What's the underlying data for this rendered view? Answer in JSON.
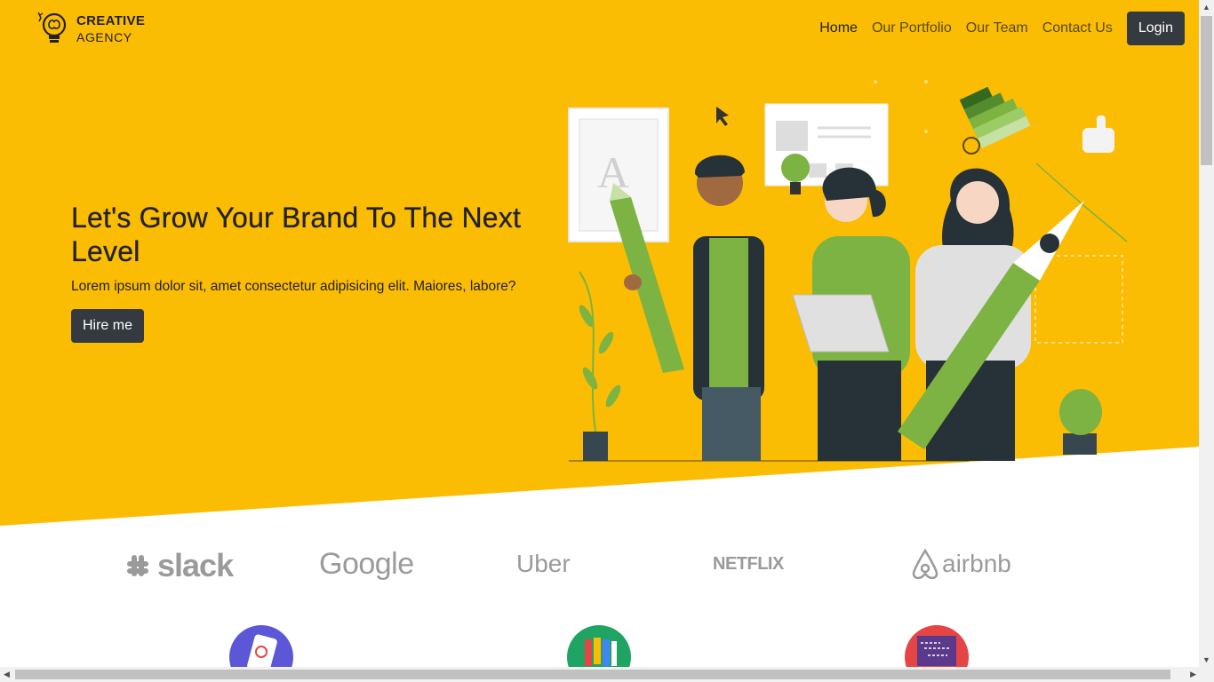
{
  "brand": {
    "line1": "CREATIVE",
    "line2": "AGENCY",
    "icon": "brain-bulb-icon"
  },
  "nav": {
    "links": [
      {
        "label": "Home",
        "active": true
      },
      {
        "label": "Our Portfolio",
        "active": false
      },
      {
        "label": "Our Team",
        "active": false
      },
      {
        "label": "Contact Us",
        "active": false
      }
    ],
    "login_label": "Login"
  },
  "hero": {
    "title": "Let's Grow Your Brand To The Next Level",
    "subtitle": "Lorem ipsum dolor sit, amet consectetur adipisicing elit. Maiores, labore?",
    "cta_label": "Hire me"
  },
  "clients": {
    "logos": [
      "slack",
      "Google",
      "Uber",
      "NETFLIX",
      "airbnb"
    ]
  },
  "services": {
    "icons": [
      "mobile-app-icon",
      "color-palette-icon",
      "code-screen-icon"
    ]
  },
  "colors": {
    "hero_bg": "#fbbc04",
    "dark": "#343a40",
    "service1": "#5b57d6",
    "service2": "#1fa463",
    "service3": "#e64545"
  }
}
